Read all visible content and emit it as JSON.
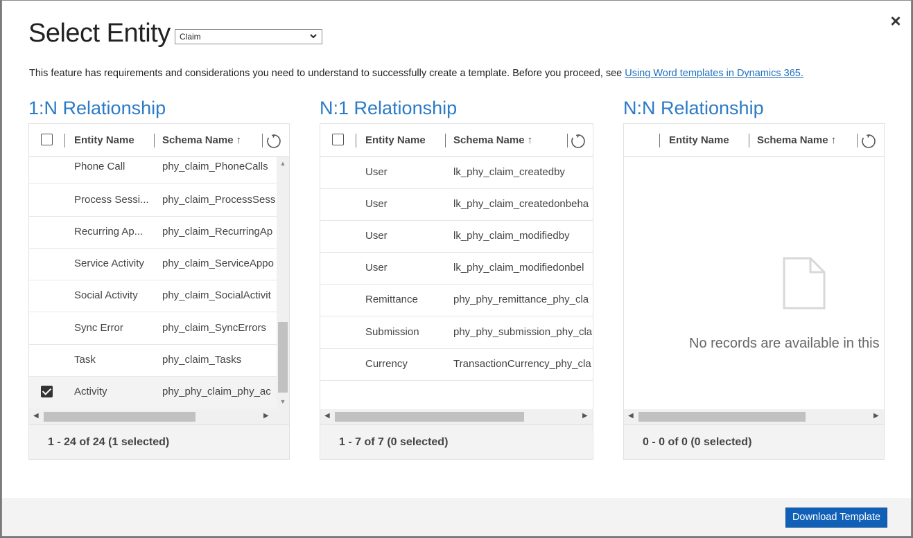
{
  "dialog": {
    "title": "Select Entity",
    "entity_select": {
      "value": "Claim"
    },
    "info_text": "This feature has requirements and considerations you need to understand to successfully create a template. Before you proceed, see ",
    "info_link": "Using Word templates in Dynamics 365.",
    "close_label": "×",
    "download_label": "Download Template"
  },
  "panels": {
    "one_to_many": {
      "title": "1:N Relationship",
      "col_entity": "Entity Name",
      "col_schema": "Schema Name",
      "sort_arrow": "↑",
      "rows": [
        {
          "entity": "Phone Call",
          "schema": "phy_claim_PhoneCalls",
          "checked": false
        },
        {
          "entity": "Process Sessi...",
          "schema": "phy_claim_ProcessSess",
          "checked": false
        },
        {
          "entity": "Recurring Ap...",
          "schema": "phy_claim_RecurringAp",
          "checked": false
        },
        {
          "entity": "Service Activity",
          "schema": "phy_claim_ServiceAppo",
          "checked": false
        },
        {
          "entity": "Social Activity",
          "schema": "phy_claim_SocialActivit",
          "checked": false
        },
        {
          "entity": "Sync Error",
          "schema": "phy_claim_SyncErrors",
          "checked": false
        },
        {
          "entity": "Task",
          "schema": "phy_claim_Tasks",
          "checked": false
        },
        {
          "entity": "Activity",
          "schema": "phy_phy_claim_phy_ac",
          "checked": true
        }
      ],
      "footer": "1 - 24 of 24 (1 selected)"
    },
    "many_to_one": {
      "title": "N:1 Relationship",
      "col_entity": "Entity Name",
      "col_schema": "Schema Name",
      "sort_arrow": "↑",
      "rows": [
        {
          "entity": "User",
          "schema": "lk_phy_claim_createdby"
        },
        {
          "entity": "User",
          "schema": "lk_phy_claim_createdonbeha"
        },
        {
          "entity": "User",
          "schema": "lk_phy_claim_modifiedby"
        },
        {
          "entity": "User",
          "schema": "lk_phy_claim_modifiedonbel"
        },
        {
          "entity": "Remittance",
          "schema": "phy_phy_remittance_phy_cla"
        },
        {
          "entity": "Submission",
          "schema": "phy_phy_submission_phy_cla"
        },
        {
          "entity": "Currency",
          "schema": "TransactionCurrency_phy_cla"
        }
      ],
      "footer": "1 - 7 of 7 (0 selected)"
    },
    "many_to_many": {
      "title": "N:N Relationship",
      "col_entity": "Entity Name",
      "col_schema": "Schema Name",
      "sort_arrow": "↑",
      "empty_text": "No records are available in this",
      "footer": "0 - 0 of 0 (0 selected)"
    }
  },
  "icons": {
    "refresh": "refresh-icon",
    "empty": "document-icon",
    "close": "close-icon"
  },
  "colors": {
    "accent": "#2b7bc7",
    "button": "#1160b7",
    "link": "#1f6fbf"
  }
}
